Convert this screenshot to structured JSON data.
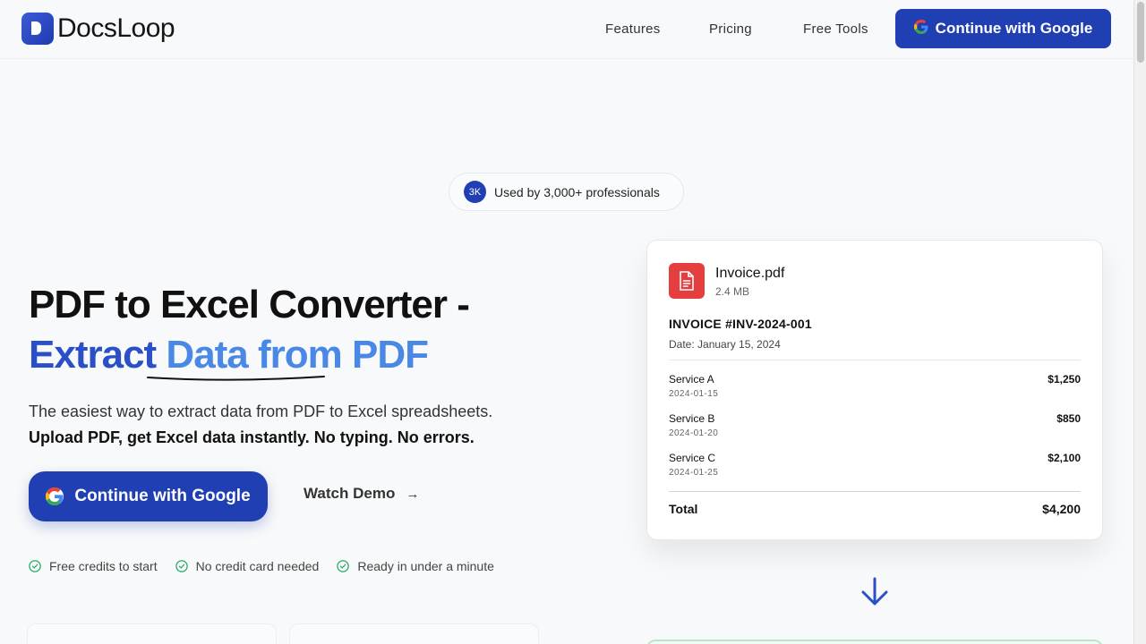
{
  "nav": {
    "brand": "DocsLoop",
    "links": [
      "Features",
      "Pricing",
      "Free Tools"
    ],
    "cta": "Continue with Google"
  },
  "badge": {
    "count": "3K",
    "text": "Used by 3,000+ professionals"
  },
  "hero": {
    "title_line1": "PDF to Excel Converter -",
    "title_line2_part1": "Extract",
    "title_line2_part2": " Data from PDF",
    "lead": "The easiest way to extract data from PDF to Excel spreadsheets.",
    "lead_bold": "Upload PDF, get Excel data instantly. No typing. No errors.",
    "primary_cta": "Continue with Google",
    "secondary_cta": "Watch Demo",
    "perks": [
      "Free credits to start",
      "No credit card needed",
      "Ready in under a minute"
    ]
  },
  "invoice_card": {
    "file_name": "Invoice.pdf",
    "file_size": "2.4 MB",
    "title": "INVOICE #INV-2024-001",
    "date": "Date: January 15, 2024",
    "items": [
      {
        "service": "Service A",
        "date": "2024-01-15",
        "amount": "$1,250"
      },
      {
        "service": "Service B",
        "date": "2024-01-20",
        "amount": "$850"
      },
      {
        "service": "Service C",
        "date": "2024-01-25",
        "amount": "$2,100"
      }
    ],
    "total_label": "Total",
    "total_amount": "$4,200"
  },
  "colors": {
    "primary": "#1f3fb3",
    "accent_blue": "#4a88e6",
    "pdf_red": "#e53e3e",
    "check_green": "#22a861"
  }
}
